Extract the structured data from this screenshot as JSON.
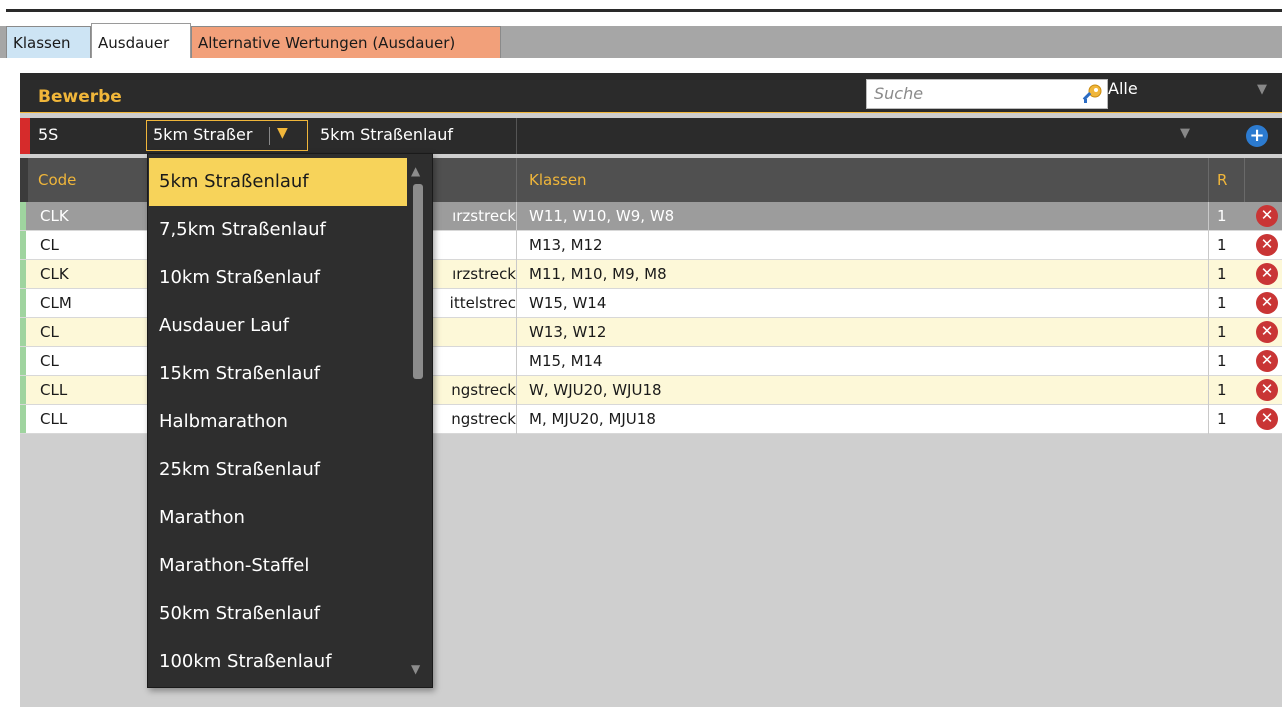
{
  "tabs": [
    {
      "label": "Klassen"
    },
    {
      "label": "Ausdauer"
    },
    {
      "label": "Alternative Wertungen (Ausdauer)"
    }
  ],
  "header": {
    "title": "Bewerbe",
    "search_placeholder": "Suche",
    "filter_value": "Alle"
  },
  "selection": {
    "code": "5S",
    "combo_text": "5km Straßer",
    "name": "5km Straßenlauf"
  },
  "table": {
    "columns": {
      "code": "Code",
      "klassen": "Klassen",
      "r": "R"
    },
    "rows": [
      {
        "code": "CLK",
        "name": "ırzstreck",
        "klassen": "W11, W10, W9, W8",
        "r": "1"
      },
      {
        "code": "CL",
        "name": "",
        "klassen": "M13, M12",
        "r": "1"
      },
      {
        "code": "CLK",
        "name": "ırzstreck",
        "klassen": "M11, M10, M9, M8",
        "r": "1"
      },
      {
        "code": "CLM",
        "name": "ittelstrec",
        "klassen": "W15, W14",
        "r": "1"
      },
      {
        "code": "CL",
        "name": "",
        "klassen": "W13, W12",
        "r": "1"
      },
      {
        "code": "CL",
        "name": "",
        "klassen": "M15, M14",
        "r": "1"
      },
      {
        "code": "CLL",
        "name": "ngstreck",
        "klassen": "W, WJU20, WJU18",
        "r": "1"
      },
      {
        "code": "CLL",
        "name": "ngstreck",
        "klassen": "M, MJU20, MJU18",
        "r": "1"
      }
    ]
  },
  "dropdown": {
    "items": [
      "5km Straßenlauf",
      "7,5km Straßenlauf",
      "10km Straßenlauf",
      "Ausdauer Lauf",
      "15km Straßenlauf",
      "Halbmarathon",
      "25km Straßenlauf",
      "Marathon",
      "Marathon-Staffel",
      "50km Straßenlauf",
      "100km Straßenlauf"
    ],
    "selected": "5km Straßenlauf"
  },
  "colors": {
    "accent": "#f0b63a",
    "dark": "#2b2b2b",
    "delete": "#c93535",
    "add": "#2c7bd0"
  },
  "icons": {
    "search": "key-search-icon",
    "add": "plus-circle-icon",
    "delete": "x-circle-icon",
    "dropdown": "triangle-down-icon"
  }
}
